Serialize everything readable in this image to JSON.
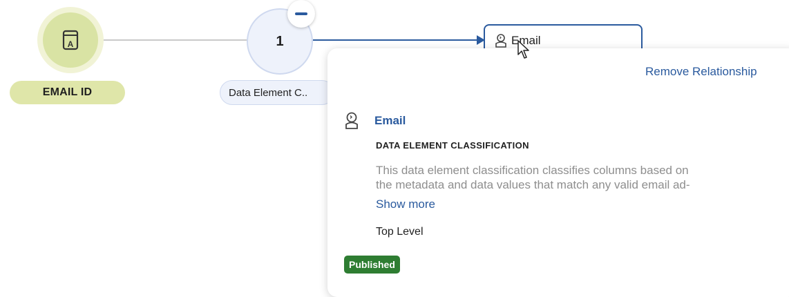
{
  "nodes": {
    "email_id": {
      "label": "EMAIL ID",
      "icon": "address-book-icon"
    },
    "group": {
      "count": "1",
      "label": "Data Element C..",
      "collapse_icon": "minus-icon"
    },
    "email": {
      "label": "Email",
      "icon": "classification-person-icon"
    }
  },
  "popover": {
    "remove_label": "Remove Relationship",
    "title": "Email",
    "type": "DATA ELEMENT CLASSIFICATION",
    "description_line1": "This data element classification classifies columns based on",
    "description_line2": "the metadata and data values that match any valid email ad-",
    "show_more": "Show more",
    "level": "Top Level",
    "status": "Published"
  },
  "colors": {
    "accent": "#2a5a9e",
    "olive_node": "#d9e3a4",
    "published": "#2e7d32"
  }
}
